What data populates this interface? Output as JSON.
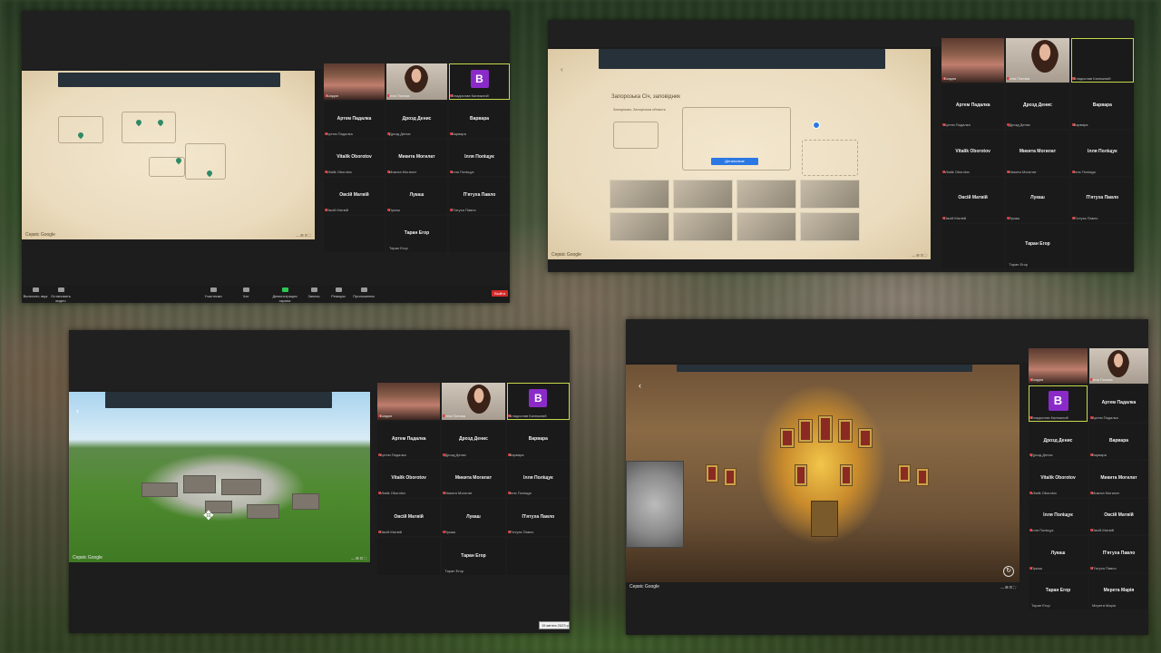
{
  "participants": {
    "bohdan": "Богдан",
    "inna": "Інна Попова",
    "vladyslav": "Владислав Калюжний",
    "avatar_letter": "B"
  },
  "grid_people": [
    {
      "name": "Артем Падалка",
      "sub": "Артем Падалка"
    },
    {
      "name": "Дрозд Денис",
      "sub": "Дрозд Денис"
    },
    {
      "name": "Варвара",
      "sub": "Варвара"
    },
    {
      "name": "Vitalik Oborotov",
      "sub": "Vitalik Oborotov"
    },
    {
      "name": "Микита Мoгилат",
      "sub": "Микита Мoгилат"
    },
    {
      "name": "Ілля Поліщук",
      "sub": "Ілля Поліщук"
    },
    {
      "name": "Овсій Матвій",
      "sub": "Овсій Матвій"
    },
    {
      "name": "Лукаш",
      "sub": "Лукаш"
    },
    {
      "name": "П'ятуха Павло",
      "sub": "П'ятуха Павло"
    },
    {
      "name": "Таран Егор",
      "sub": "Таран Егор"
    },
    {
      "name": "Мерета Марія",
      "sub": "Мерета Марія"
    }
  ],
  "toolbar": {
    "mute": "Включить звук",
    "video": "Остановить видео",
    "participants": "Участники",
    "chat": "Чат",
    "share": "Демонстрация экрана",
    "record": "Запись",
    "reactions": "Реакции",
    "apps": "Приложения",
    "end": "Выйти"
  },
  "pano": {
    "title": "Запорозька Січ, заповідник",
    "location": "Запоріжжя, Запорізька область",
    "button": "Детальніше",
    "google": "Сервіс Google"
  },
  "date_chip": "15 квітня 2023 р. Запорожж"
}
